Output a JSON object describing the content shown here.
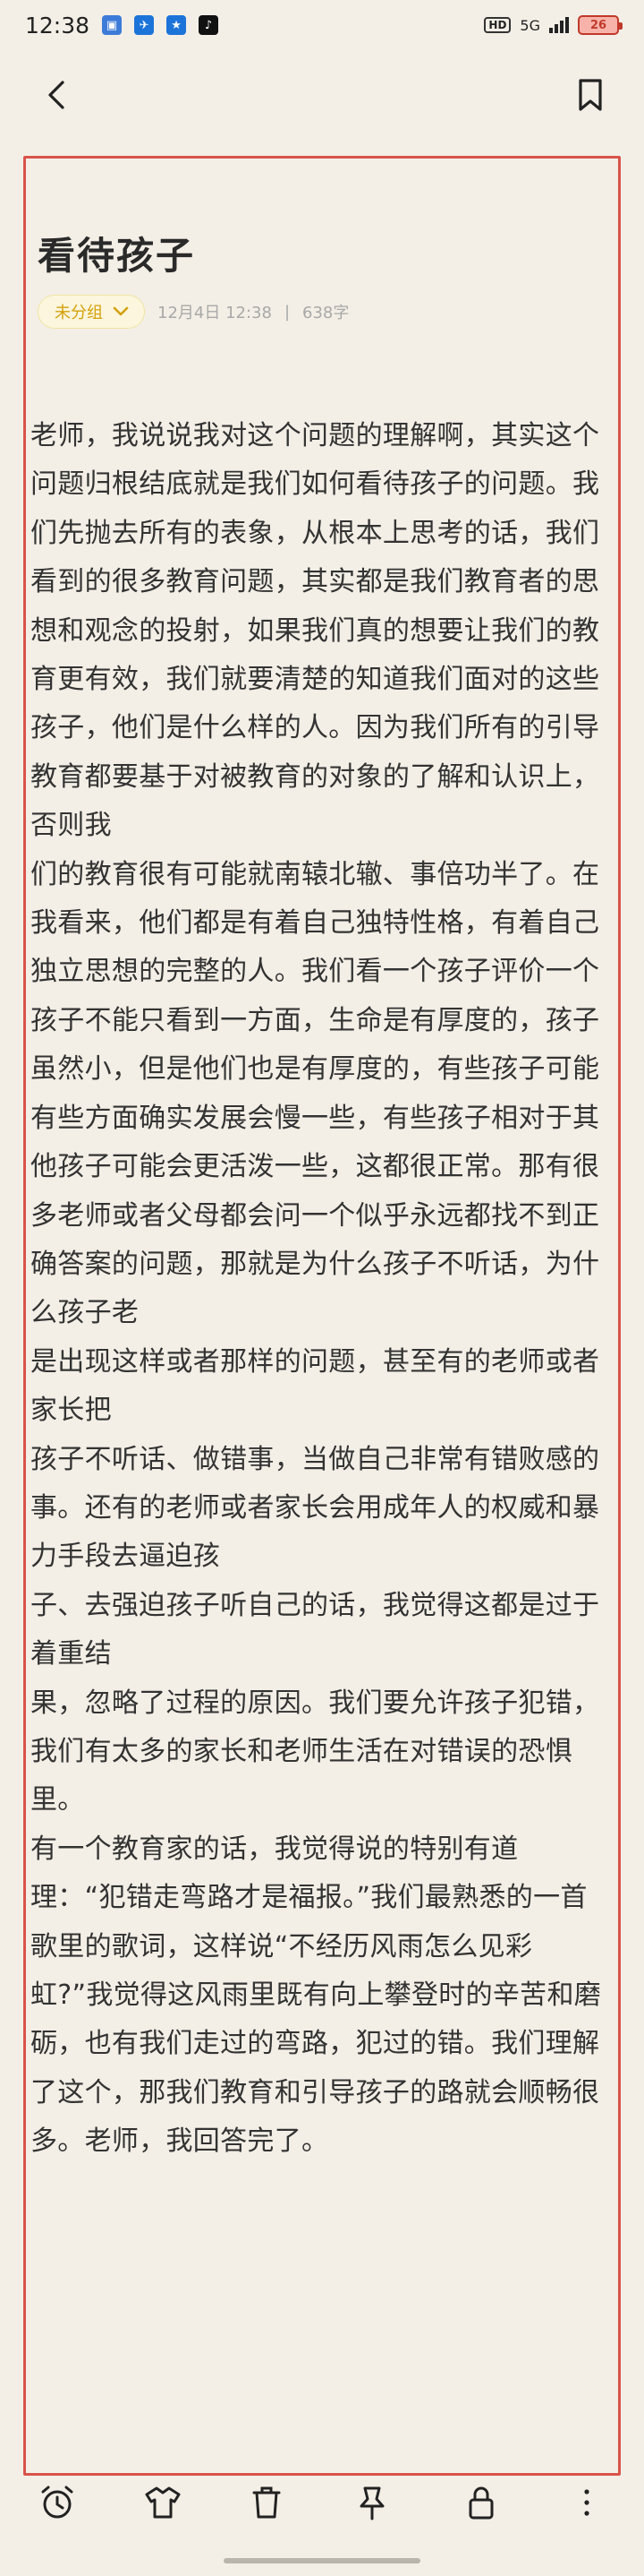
{
  "status_bar": {
    "time": "12:38",
    "network": "5G",
    "battery": "26"
  },
  "icons": {
    "back": "chevron-left-icon",
    "bookmark": "bookmark-icon",
    "group_arrow": "chevron-down-icon",
    "toolbar": [
      "alarm-clock-icon",
      "shirt-icon",
      "trash-icon",
      "pin-icon",
      "lock-icon",
      "more-vertical-icon"
    ]
  },
  "note": {
    "title": "看待孩子",
    "group": "未分组",
    "date": "12月4日 12:38",
    "separator": "|",
    "char_count": "638字",
    "paragraphs": [
      "老师，我说说我对这个问题的理解啊，其实这个问题归根结底就是我们如何看待孩子的问题。我们先抛去所有的表象，从根本上思考的话，我们看到的很多教育问题，其实都是我们教育者的思想和观念的投射，如果我们真的想要让我们的教育更有效，我们就要清楚的知道我们面对的这些孩子，他们是什么样的人。因为我们所有的引导教育都要基于对被教育的对象的了解和认识上，否则我",
      "们的教育很有可能就南辕北辙、事倍功半了。在我看来，他们都是有着自己独特性格，有着自己独立思想的完整的人。我们看一个孩子评价一个孩子不能只看到一方面，生命是有厚度的，孩子虽然小，但是他们也是有厚度的，有些孩子可能有些方面确实发展会慢一些，有些孩子相对于其他孩子可能会更活泼一些，这都很正常。那有很多老师或者父母都会问一个似乎永远都找不到正确答案的问题，那就是为什么孩子不听话，为什么孩子老",
      "是出现这样或者那样的问题，甚至有的老师或者家长把",
      "孩子不听话、做错事，当做自己非常有错败感的事。还有的老师或者家长会用成年人的权威和暴力手段去逼迫孩",
      "子、去强迫孩子听自己的话，我觉得这都是过于着重结",
      "果，忽略了过程的原因。我们要允许孩子犯错，我们有太多的家长和老师生活在对错误的恐惧里。",
      "有一个教育家的话，我觉得说的特别有道理：“犯错走弯路才是福报。”我们最熟悉的一首歌里的歌词，这样说“不经历风雨怎么见彩虹?”我觉得这风雨里既有向上攀登时的辛苦和磨砺，也有我们走过的弯路，犯过的错。我们理解了这个，那我们教育和引导孩子的路就会顺畅很多。老师，我回答完了。"
    ]
  }
}
